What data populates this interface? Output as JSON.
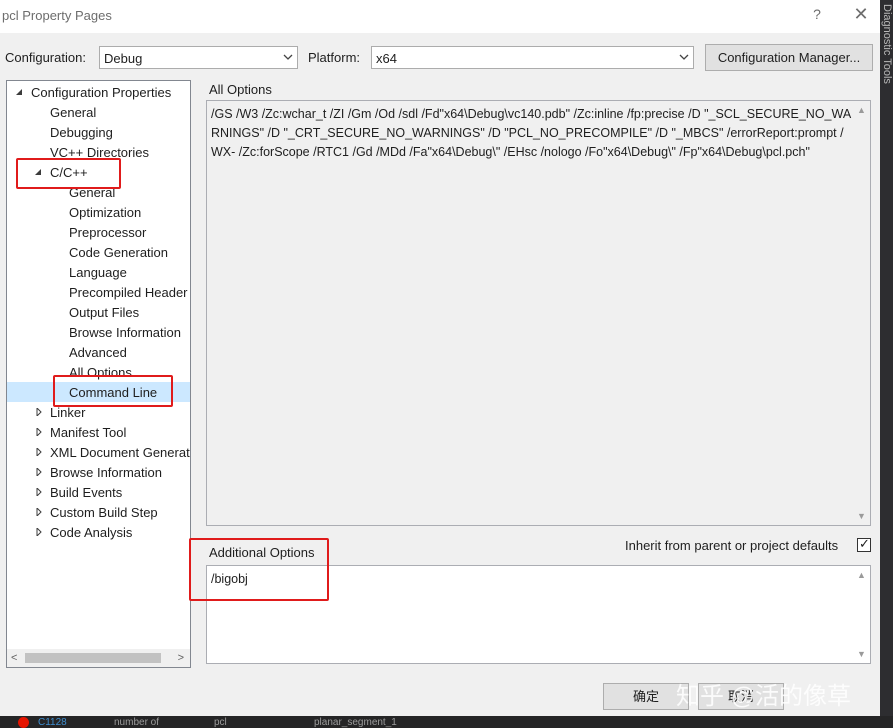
{
  "window": {
    "title": "pcl Property Pages",
    "help_glyph": "?",
    "close_glyph": "✕"
  },
  "config": {
    "configuration_label": "Configuration:",
    "configuration_value": "Debug",
    "platform_label": "Platform:",
    "platform_value": "x64",
    "manager_button": "Configuration Manager..."
  },
  "tree": {
    "root": "Configuration Properties",
    "items": [
      "General",
      "Debugging",
      "VC++ Directories",
      "C/C++",
      "General",
      "Optimization",
      "Preprocessor",
      "Code Generation",
      "Language",
      "Precompiled Header",
      "Output Files",
      "Browse Information",
      "Advanced",
      "All Options",
      "Command Line",
      "Linker",
      "Manifest Tool",
      "XML Document Generat",
      "Browse Information",
      "Build Events",
      "Custom Build Step",
      "Code Analysis"
    ],
    "selected": "Command Line"
  },
  "all_options": {
    "label": "All Options",
    "text": "/GS /W3 /Zc:wchar_t /ZI /Gm /Od /sdl /Fd\"x64\\Debug\\vc140.pdb\" /Zc:inline /fp:precise /D \"_SCL_SECURE_NO_WARNINGS\" /D \"_CRT_SECURE_NO_WARNINGS\" /D \"PCL_NO_PRECOMPILE\" /D \"_MBCS\" /errorReport:prompt /WX- /Zc:forScope /RTC1 /Gd /MDd /Fa\"x64\\Debug\\\" /EHsc /nologo /Fo\"x64\\Debug\\\" /Fp\"x64\\Debug\\pcl.pch\""
  },
  "additional_options": {
    "label": "Additional Options",
    "value": "/bigobj",
    "inherit_label": "Inherit from parent or project defaults",
    "inherit_checked": true,
    "check_glyph": "✓"
  },
  "footer": {
    "ok": "确定",
    "cancel": "取消"
  },
  "watermark": "知乎 @活的像草",
  "side_panel_text": "Diagnostic Tools",
  "error_strip": {
    "code": "C1128",
    "col2": "number of",
    "col3": "pcl",
    "col4": "planar_segment_1"
  },
  "colors": {
    "highlight_box": "#e01b1b",
    "selection": "#cce8ff"
  }
}
